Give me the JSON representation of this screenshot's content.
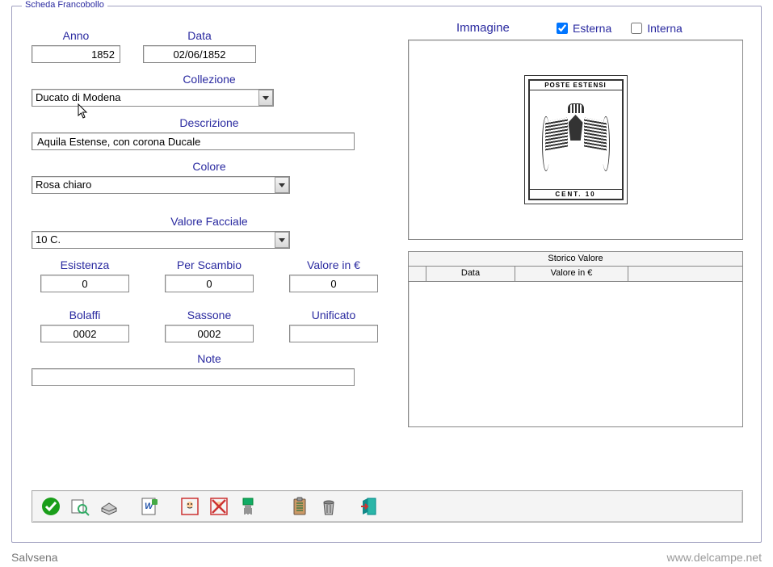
{
  "legend": "Scheda Francobollo",
  "left": {
    "anno_label": "Anno",
    "anno_value": "1852",
    "data_label": "Data",
    "data_value": "02/06/1852",
    "collezione_label": "Collezione",
    "collezione_value": "Ducato di Modena",
    "descrizione_label": "Descrizione",
    "descrizione_value": "Aquila Estense, con corona Ducale",
    "colore_label": "Colore",
    "colore_value": "Rosa chiaro",
    "valore_facciale_label": "Valore Facciale",
    "valore_facciale_value": "10 C.",
    "esistenza_label": "Esistenza",
    "esistenza_value": "0",
    "per_scambio_label": "Per Scambio",
    "per_scambio_value": "0",
    "valore_eur_label": "Valore in €",
    "valore_eur_value": "0",
    "bolaffi_label": "Bolaffi",
    "bolaffi_value": "0002",
    "sassone_label": "Sassone",
    "sassone_value": "0002",
    "unificato_label": "Unificato",
    "unificato_value": "",
    "note_label": "Note",
    "note_value": ""
  },
  "right": {
    "immagine_label": "Immagine",
    "esterna_label": "Esterna",
    "interna_label": "Interna",
    "esterna_checked": true,
    "interna_checked": false,
    "stamp_top": "POSTE ESTENSI",
    "stamp_bottom": "CENT.  10",
    "storico_title": "Storico Valore",
    "storico_col1": "Data",
    "storico_col2": "Valore in €"
  },
  "footer": {
    "left": "Salvsena",
    "right": "www.delcampe.net"
  }
}
